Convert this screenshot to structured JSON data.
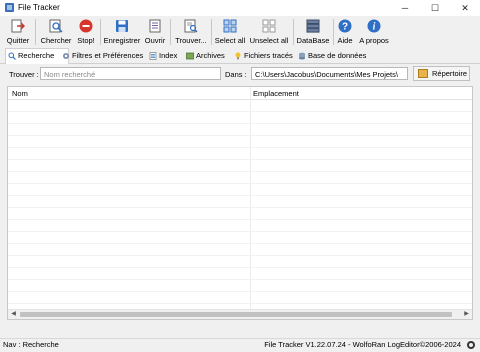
{
  "window": {
    "title": "File Tracker"
  },
  "toolbar": {
    "buttons": [
      {
        "label": "Quitter",
        "icon": "exit-icon"
      },
      {
        "label": "Chercher",
        "icon": "search-icon"
      },
      {
        "label": "Stop!",
        "icon": "stop-icon"
      },
      {
        "label": "Enregistrer",
        "icon": "save-icon"
      },
      {
        "label": "Ouvrir",
        "icon": "open-icon"
      },
      {
        "label": "Trouver...",
        "icon": "find-icon"
      },
      {
        "label": "Select all",
        "icon": "select-all-icon"
      },
      {
        "label": "Unselect all",
        "icon": "unselect-all-icon"
      },
      {
        "label": "DataBase",
        "icon": "database-icon"
      },
      {
        "label": "Aide",
        "icon": "help-icon"
      },
      {
        "label": "A propos",
        "icon": "info-icon"
      }
    ]
  },
  "tabs": [
    {
      "label": "Recherche",
      "active": true
    },
    {
      "label": "Filtres et Préférences"
    },
    {
      "label": "Index"
    },
    {
      "label": "Archives"
    },
    {
      "label": "Fichiers tracés"
    },
    {
      "label": "Base de données"
    }
  ],
  "search": {
    "find_label": "Trouver :",
    "find_placeholder": "Nom recherché",
    "in_label": "Dans :",
    "path_value": "C:\\Users\\Jacobus\\Documents\\Mes Projets\\",
    "browse_label": "Répertoire"
  },
  "table": {
    "columns": [
      "Nom",
      "Emplacement"
    ],
    "rows": []
  },
  "status": {
    "nav": "Nav : Recherche",
    "version": "File Tracker V1.22.07.24 - WolfoRan LogEditor©2006-2024"
  },
  "colors": {
    "accent": "#2f6fc6",
    "stop": "#d9342b",
    "folder": "#e8b44a"
  }
}
